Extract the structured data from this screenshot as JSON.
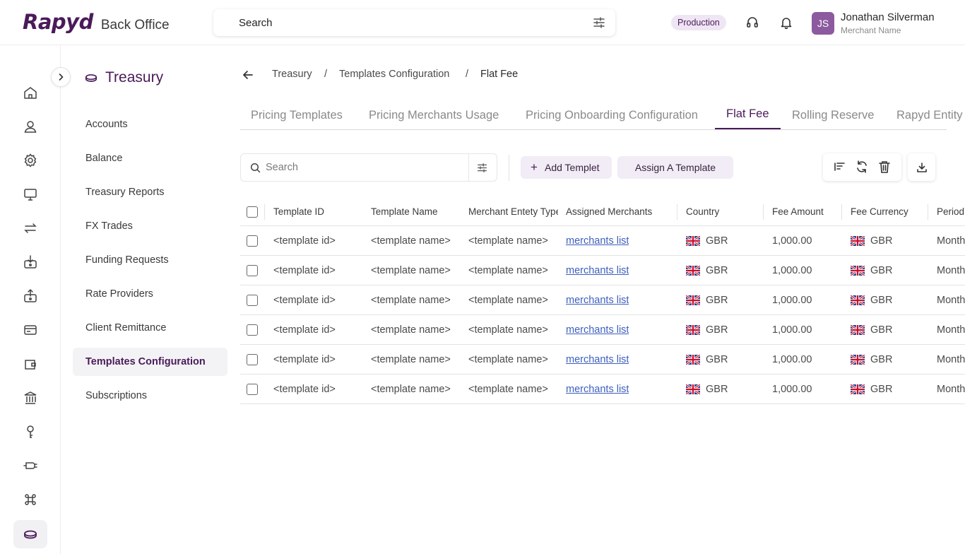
{
  "header": {
    "brand": "Rapyd",
    "product": "Back Office",
    "search_placeholder": "Search",
    "environment": "Production",
    "user": {
      "initials": "JS",
      "name": "Jonathan Silverman",
      "subtitle": "Merchant Name"
    }
  },
  "rail": {
    "items": [
      "home-icon",
      "user-icon",
      "gear-icon",
      "monitor-icon",
      "transfer-icon",
      "payin-icon",
      "payout-icon",
      "card-icon",
      "wallet-icon",
      "bank-icon",
      "key-icon",
      "plug-icon",
      "command-icon",
      "treasury-icon"
    ],
    "active": "treasury-icon"
  },
  "section": {
    "title": "Treasury",
    "items": [
      "Accounts",
      "Balance",
      "Treasury Reports",
      "FX Trades",
      "Funding Requests",
      "Rate Providers",
      "Client Remittance",
      "Templates Configuration",
      "Subscriptions"
    ],
    "active": "Templates Configuration"
  },
  "breadcrumb": [
    "Treasury",
    "Templates Configuration",
    "Flat Fee"
  ],
  "tabs": [
    "Pricing Templates",
    "Pricing Merchants Usage",
    "Pricing Onboarding Configuration",
    "Flat Fee",
    "Rolling Reserve",
    "Rapyd Entity"
  ],
  "active_tab": "Flat Fee",
  "toolbar": {
    "search_placeholder": "Search",
    "add_label": "Add Templet",
    "assign_label": "Assign A Template"
  },
  "table": {
    "columns": [
      "Template ID",
      "Template Name",
      "Merchant Entety Type",
      "Assigned Merchants",
      "Country",
      "Fee Amount",
      "Fee Currency",
      "Period"
    ],
    "rows": [
      {
        "template_id": "<template id>",
        "template_name": "<template name>",
        "merchant_entity_type": "<template name>",
        "assigned_merchants": "merchants list",
        "country": "GBR",
        "fee_amount": "1,000.00",
        "fee_currency": "GBR",
        "period": "Monthly"
      },
      {
        "template_id": "<template id>",
        "template_name": "<template name>",
        "merchant_entity_type": "<template name>",
        "assigned_merchants": "merchants list",
        "country": "GBR",
        "fee_amount": "1,000.00",
        "fee_currency": "GBR",
        "period": "Monthly"
      },
      {
        "template_id": "<template id>",
        "template_name": "<template name>",
        "merchant_entity_type": "<template name>",
        "assigned_merchants": "merchants list",
        "country": "GBR",
        "fee_amount": "1,000.00",
        "fee_currency": "GBR",
        "period": "Monthly"
      },
      {
        "template_id": "<template id>",
        "template_name": "<template name>",
        "merchant_entity_type": "<template name>",
        "assigned_merchants": "merchants list",
        "country": "GBR",
        "fee_amount": "1,000.00",
        "fee_currency": "GBR",
        "period": "Monthly"
      },
      {
        "template_id": "<template id>",
        "template_name": "<template name>",
        "merchant_entity_type": "<template name>",
        "assigned_merchants": "merchants list",
        "country": "GBR",
        "fee_amount": "1,000.00",
        "fee_currency": "GBR",
        "period": "Monthly"
      },
      {
        "template_id": "<template id>",
        "template_name": "<template name>",
        "merchant_entity_type": "<template name>",
        "assigned_merchants": "merchants list",
        "country": "GBR",
        "fee_amount": "1,000.00",
        "fee_currency": "GBR",
        "period": "Monthly"
      }
    ]
  },
  "colors": {
    "brand": "#4b1a5a",
    "link": "#3e5fbd",
    "badge_bg": "#efe6f4",
    "button_bg": "#f1ecf5"
  }
}
